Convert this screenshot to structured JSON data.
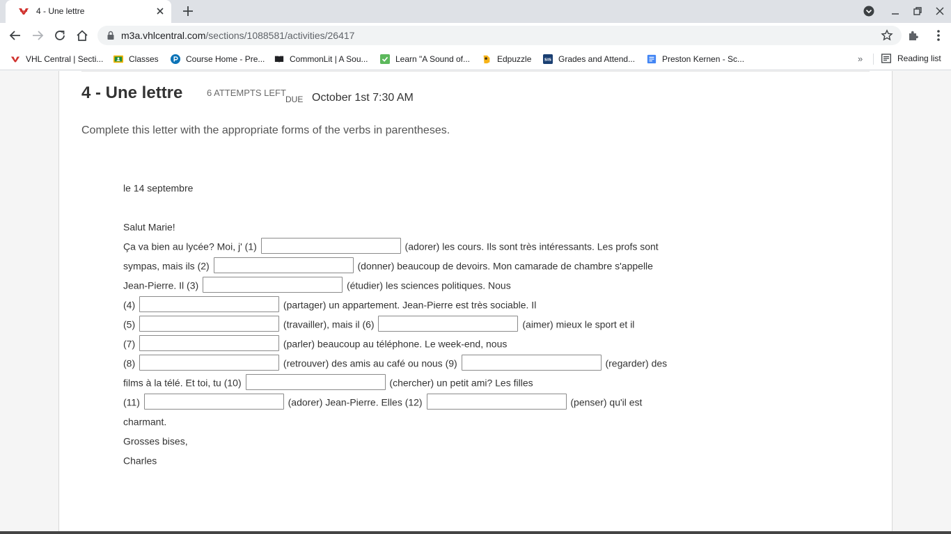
{
  "browser": {
    "tab": {
      "title": "4 - Une lettre"
    },
    "url": {
      "host": "m3a.vhlcentral.com",
      "path": "/sections/1088581/activities/26417"
    },
    "bookmarks": [
      {
        "label": "VHL Central | Secti...",
        "icon": "vhl-logo-icon"
      },
      {
        "label": "Classes",
        "icon": "google-classroom-icon"
      },
      {
        "label": "Course Home - Pre...",
        "icon": "pearson-icon"
      },
      {
        "label": "CommonLit | A Sou...",
        "icon": "book-icon"
      },
      {
        "label": "Learn \"A Sound of...",
        "icon": "checkmark-icon"
      },
      {
        "label": "Edpuzzle",
        "icon": "edpuzzle-icon"
      },
      {
        "label": "Grades and Attend...",
        "icon": "sis-icon"
      },
      {
        "label": "Preston Kernen - Sc...",
        "icon": "google-docs-icon"
      }
    ],
    "more_label": "»",
    "reading_list": "Reading list"
  },
  "activity": {
    "title": "4 - Une lettre",
    "attempts": "6 ATTEMPTS LEFT",
    "due_label": "DUE",
    "due_date": "October 1st 7:30 AM",
    "instructions": "Complete this letter with the appropriate forms of the verbs in parentheses."
  },
  "letter": {
    "date": "le 14 septembre",
    "greeting": "Salut Marie!",
    "l1a": "Ça va bien au lycée? Moi, j' (1)",
    "l1b": "(adorer) les cours. Ils sont très intéressants. Les profs sont",
    "l2a": "sympas, mais ils (2)",
    "l2b": "(donner) beaucoup de devoirs. Mon camarade de chambre s'appelle",
    "l3a": "Jean-Pierre. Il (3)",
    "l3b": "(étudier) les sciences politiques. Nous",
    "l4a": "(4)",
    "l4b": "(partager) un appartement. Jean-Pierre est très sociable. Il",
    "l5a": "(5)",
    "l5b": "(travailler), mais il (6)",
    "l5c": "(aimer) mieux le sport et il",
    "l6a": "(7)",
    "l6b": "(parler) beaucoup au téléphone. Le week-end, nous",
    "l7a": "(8)",
    "l7b": "(retrouver) des amis au café ou nous (9)",
    "l7c": "(regarder) des",
    "l8a": "films à la télé. Et toi, tu (10)",
    "l8b": "(chercher) un petit ami? Les filles",
    "l9a": "(11)",
    "l9b": "(adorer) Jean-Pierre. Elles (12)",
    "l9c": "(penser) qu'il est",
    "l10": "charmant.",
    "closing": "Grosses bises,",
    "signature": "Charles"
  },
  "answers": [
    "",
    "",
    "",
    "",
    "",
    "",
    "",
    "",
    "",
    "",
    "",
    ""
  ]
}
